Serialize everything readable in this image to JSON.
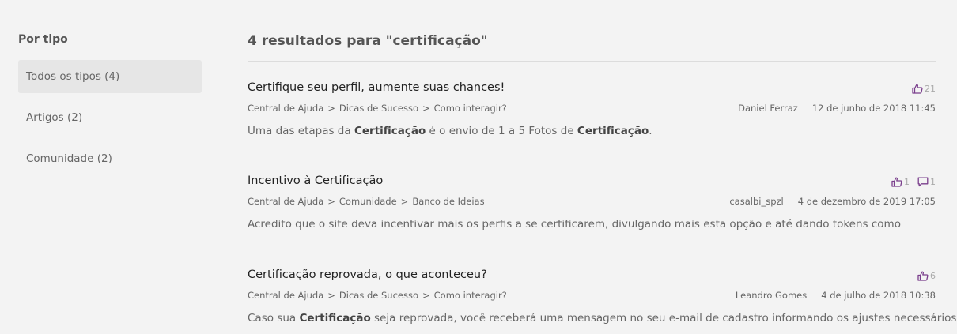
{
  "sidebar": {
    "heading": "Por tipo",
    "items": [
      {
        "label": "Todos os tipos (4)",
        "active": true
      },
      {
        "label": "Artigos (2)",
        "active": false
      },
      {
        "label": "Comunidade (2)",
        "active": false
      }
    ]
  },
  "main": {
    "results_title": "4 resultados para \"certificação\"",
    "results": [
      {
        "title": "Certifique seu perfil, aumente suas chances!",
        "likes": "21",
        "comments": null,
        "breadcrumb": [
          "Central de Ajuda",
          "Dicas de Sucesso",
          "Como interagir?"
        ],
        "author": "Daniel Ferraz",
        "date": "12 de junho de 2018 11:45",
        "snippet": [
          {
            "t": "Uma das etapas da ",
            "b": false
          },
          {
            "t": "Certificação",
            "b": true
          },
          {
            "t": " é o envio de 1 a 5 Fotos de ",
            "b": false
          },
          {
            "t": "Certificação",
            "b": true
          },
          {
            "t": ".",
            "b": false
          }
        ]
      },
      {
        "title": "Incentivo à Certificação",
        "likes": "1",
        "comments": "1",
        "breadcrumb": [
          "Central de Ajuda",
          "Comunidade",
          "Banco de Ideias"
        ],
        "author": "casalbi_spzl",
        "date": "4 de dezembro de 2019 17:05",
        "snippet": [
          {
            "t": "Acredito que o site deva incentivar mais os perfis a se certificarem, divulgando mais esta opção e até dando tokens como",
            "b": false
          }
        ]
      },
      {
        "title": "Certificação reprovada, o que aconteceu?",
        "likes": "6",
        "comments": null,
        "breadcrumb": [
          "Central de Ajuda",
          "Dicas de Sucesso",
          "Como interagir?"
        ],
        "author": "Leandro Gomes",
        "date": "4 de julho de 2018 10:38",
        "snippet": [
          {
            "t": "Caso sua ",
            "b": false
          },
          {
            "t": "Certificação",
            "b": true
          },
          {
            "t": " seja reprovada, você receberá uma mensagem no seu e-mail de cadastro informando os ajustes necessários",
            "b": false
          }
        ]
      }
    ],
    "breadcrumb_separator": ">"
  },
  "colors": {
    "accent_icon": "#7a3e8c",
    "background": "#f3f3f3",
    "active_filter_bg": "#e6e6e6"
  },
  "icons": {
    "like": "thumbs-up-icon",
    "comment": "comment-icon"
  }
}
